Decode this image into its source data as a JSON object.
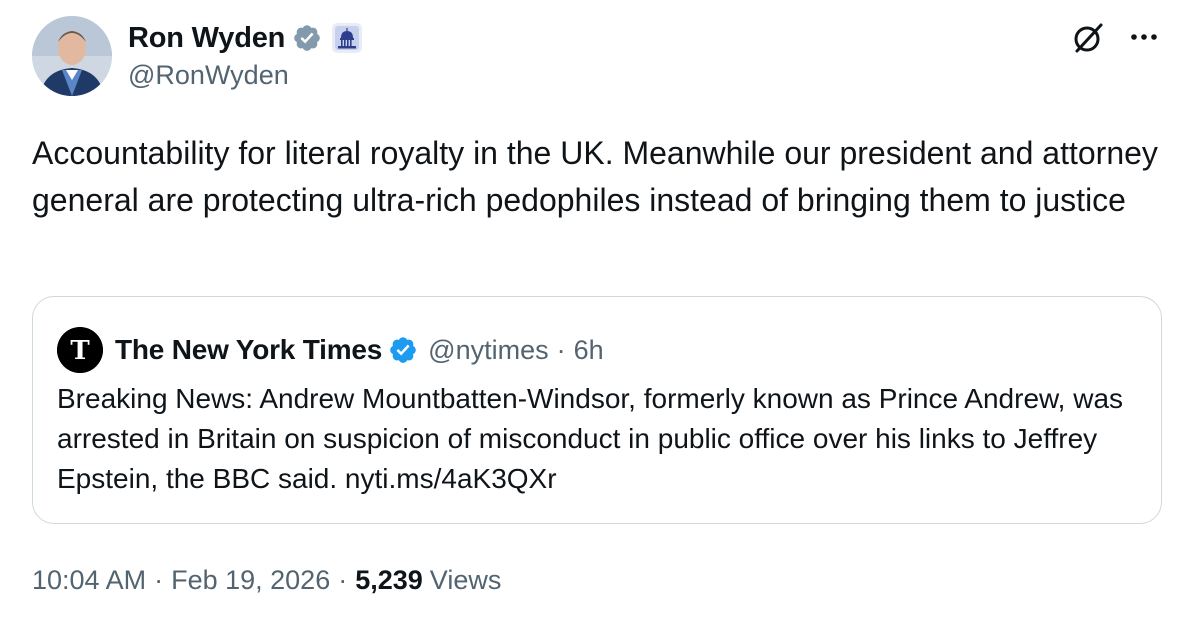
{
  "author": {
    "name": "Ron Wyden",
    "handle": "@RonWyden",
    "verified_color": "#829aab"
  },
  "tweet": {
    "text": "Accountability for literal royalty in the UK. Meanwhile our president and attorney general are protecting ultra-rich pedophiles instead of bringing them to justice"
  },
  "quote": {
    "name": "The New York Times",
    "handle": "@nytimes",
    "separator": "·",
    "time": "6h",
    "text": "Breaking News: Andrew Mountbatten-Windsor, formerly known as Prince Andrew, was arrested in Britain on suspicion of misconduct in public office over his links to Jeffrey Epstein, the BBC said. nyti.ms/4aK3QXr",
    "verified_color": "#1d9bf0"
  },
  "meta": {
    "time": "10:04 AM",
    "sep1": "·",
    "date": "Feb 19, 2026",
    "sep2": "·",
    "views_count": "5,239",
    "views_label": "Views"
  },
  "icons": {
    "grok": "grok-icon",
    "more": "more-icon",
    "government_badge": "capitol-icon",
    "gray_badge": "verified-gray-icon",
    "blue_badge": "verified-blue-icon"
  }
}
